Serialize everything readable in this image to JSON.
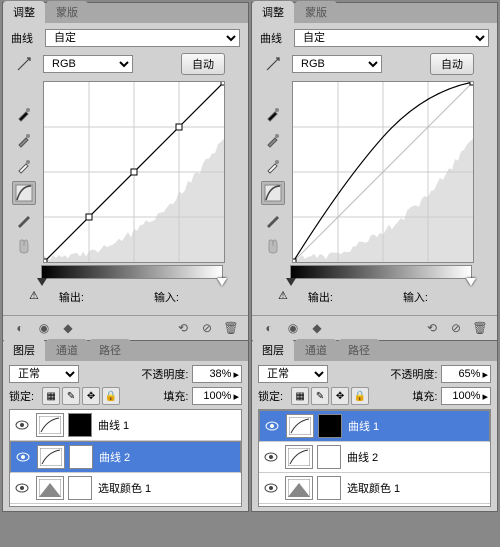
{
  "left": {
    "tabs": [
      "调整",
      "蒙版"
    ],
    "adjustmentLabel": "曲线",
    "preset": "自定",
    "channel": "RGB",
    "autoBtn": "自动",
    "outputLabel": "输出:",
    "inputLabel": "输入:",
    "curve": {
      "type": "linear",
      "points": [
        [
          0,
          180
        ],
        [
          45,
          135
        ],
        [
          90,
          90
        ],
        [
          135,
          45
        ],
        [
          180,
          0
        ]
      ]
    },
    "layersTabs": [
      "图层",
      "通道",
      "路径"
    ],
    "blendMode": "正常",
    "opacityLabel": "不透明度:",
    "opacity": "38%",
    "lockLabel": "锁定:",
    "fillLabel": "填充:",
    "fill": "100%",
    "layers": [
      {
        "name": "曲线 1",
        "mask": "black",
        "selected": false,
        "type": "curves"
      },
      {
        "name": "曲线 2",
        "mask": "white",
        "selected": true,
        "type": "curves"
      },
      {
        "name": "选取颜色 1",
        "mask": "white",
        "selected": false,
        "type": "selective"
      }
    ]
  },
  "right": {
    "tabs": [
      "调整",
      "蒙版"
    ],
    "adjustmentLabel": "曲线",
    "preset": "自定",
    "channel": "RGB",
    "autoBtn": "自动",
    "outputLabel": "输出:",
    "inputLabel": "输入:",
    "curve": {
      "type": "curve",
      "points": [
        [
          0,
          180
        ],
        [
          40,
          110
        ],
        [
          90,
          55
        ],
        [
          140,
          20
        ],
        [
          180,
          0
        ]
      ]
    },
    "layersTabs": [
      "图层",
      "通道",
      "路径"
    ],
    "blendMode": "正常",
    "opacityLabel": "不透明度:",
    "opacity": "65%",
    "lockLabel": "锁定:",
    "fillLabel": "填充:",
    "fill": "100%",
    "layers": [
      {
        "name": "曲线 1",
        "mask": "black",
        "selected": true,
        "type": "curves"
      },
      {
        "name": "曲线 2",
        "mask": "white",
        "selected": false,
        "type": "curves"
      },
      {
        "name": "选取颜色 1",
        "mask": "white",
        "selected": false,
        "type": "selective"
      }
    ]
  },
  "chart_data": [
    {
      "type": "line",
      "title": "Curves (left, linear)",
      "xlabel": "Input",
      "ylabel": "Output",
      "xlim": [
        0,
        255
      ],
      "ylim": [
        0,
        255
      ],
      "series": [
        {
          "name": "RGB",
          "x": [
            0,
            64,
            128,
            192,
            255
          ],
          "y": [
            0,
            64,
            128,
            192,
            255
          ]
        }
      ]
    },
    {
      "type": "line",
      "title": "Curves (right, brightened)",
      "xlabel": "Input",
      "ylabel": "Output",
      "xlim": [
        0,
        255
      ],
      "ylim": [
        0,
        255
      ],
      "series": [
        {
          "name": "RGB",
          "x": [
            0,
            57,
            128,
            199,
            255
          ],
          "y": [
            0,
            100,
            178,
            227,
            255
          ]
        }
      ]
    }
  ]
}
